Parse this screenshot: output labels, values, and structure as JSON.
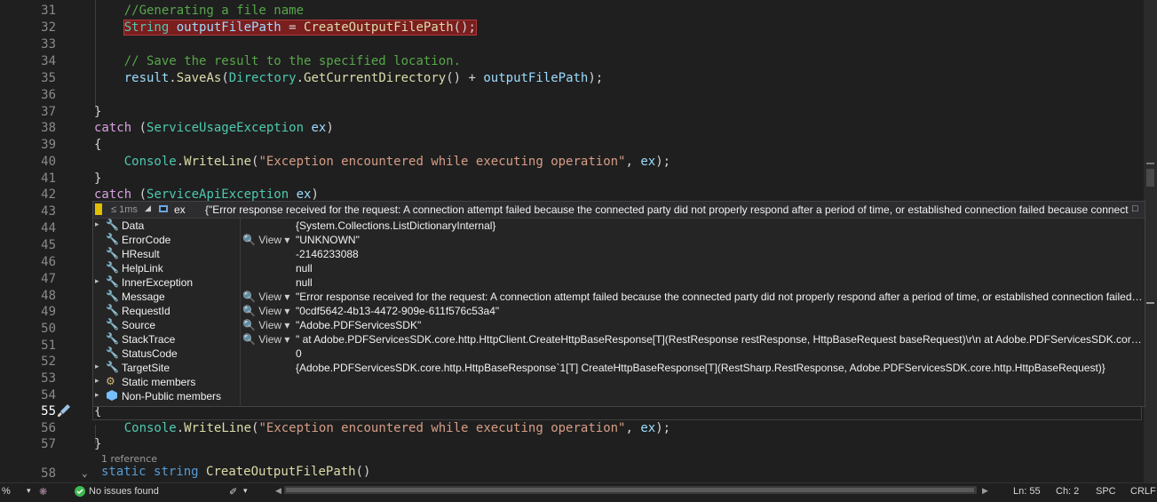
{
  "line_numbers": [
    "31",
    "32",
    "33",
    "34",
    "35",
    "36",
    "37",
    "38",
    "39",
    "40",
    "41",
    "42",
    "43",
    "44",
    "45",
    "46",
    "47",
    "48",
    "49",
    "50",
    "51",
    "52",
    "53",
    "54",
    "55",
    "56",
    "57",
    "58"
  ],
  "active_line": "55",
  "code": {
    "l31_comment": "//Generating a file name",
    "l32_type": "String",
    "l32_var": "outputFilePath",
    "l32_eq": " = ",
    "l32_fn": "CreateOutputFilePath",
    "l32_end": "();",
    "l34_comment": "// Save the result to the specified location.",
    "l35_obj": "result",
    "l35_dot": ".",
    "l35_fn": "SaveAs",
    "l35_p1": "(",
    "l35_cls": "Directory",
    "l35_dot2": ".",
    "l35_fn2": "GetCurrentDirectory",
    "l35_p2": "() + ",
    "l35_var": "outputFilePath",
    "l35_end": ");",
    "l37": "}",
    "l38_kw": "catch",
    "l38_p": " (",
    "l38_ty": "ServiceUsageException",
    "l38_var": " ex",
    "l38_end": ")",
    "l39": "{",
    "l40_cls": "Console",
    "l40_dot": ".",
    "l40_fn": "WriteLine",
    "l40_p": "(",
    "l40_str": "\"Exception encountered while executing operation\"",
    "l40_mid": ", ",
    "l40_var": "ex",
    "l40_end": ");",
    "l41": "}",
    "l42_kw": "catch",
    "l42_p": " (",
    "l42_ty": "ServiceApiException",
    "l42_var": " ex",
    "l42_end": ")",
    "l55": "{",
    "l56_cls": "Console",
    "l56_dot": ".",
    "l56_fn": "WriteLine",
    "l56_p": "(",
    "l56_str": "\"Exception encountered while executing operation\"",
    "l56_mid": ", ",
    "l56_var": "ex",
    "l56_end": ");",
    "l57": "}",
    "l58_kw1": "static",
    "l58_kw2": "string",
    "l58_fn": "CreateOutputFilePath",
    "l58_end": "()",
    "codelens": "1 reference",
    "timing": "≤ 1ms"
  },
  "datatip": {
    "header_name": "ex",
    "header_value": "{\"Error response received for the request: A connection attempt failed because the connected party did not properly respond after a period of time, or established connection failed because connect...",
    "view_label": "View",
    "rows": [
      {
        "name": "Data",
        "value": "{System.Collections.ListDictionaryInternal}",
        "expandable": true,
        "has_view": false
      },
      {
        "name": "ErrorCode",
        "value": "\"UNKNOWN\"",
        "expandable": false,
        "has_view": true
      },
      {
        "name": "HResult",
        "value": "-2146233088",
        "expandable": false,
        "has_view": false
      },
      {
        "name": "HelpLink",
        "value": "null",
        "expandable": false,
        "has_view": false
      },
      {
        "name": "InnerException",
        "value": "null",
        "expandable": true,
        "has_view": false
      },
      {
        "name": "Message",
        "value": "\"Error response received for the request: A connection attempt failed because the connected party did not properly respond after a period of time, or established connection failed b...",
        "expandable": false,
        "has_view": true
      },
      {
        "name": "RequestId",
        "value": "\"0cdf5642-4b13-4472-909e-611f576c53a4\"",
        "expandable": false,
        "has_view": true
      },
      {
        "name": "Source",
        "value": "\"Adobe.PDFServicesSDK\"",
        "expandable": false,
        "has_view": true
      },
      {
        "name": "StackTrace",
        "value": "\"   at Adobe.PDFServicesSDK.core.http.HttpClient.CreateHttpBaseResponse[T](RestResponse restResponse, HttpBaseRequest baseRequest)\\r\\n   at Adobe.PDFServicesSDK.core.http.I...",
        "expandable": false,
        "has_view": true
      },
      {
        "name": "StatusCode",
        "value": "0",
        "expandable": false,
        "has_view": false
      },
      {
        "name": "TargetSite",
        "value": "{Adobe.PDFServicesSDK.core.http.HttpBaseResponse`1[T] CreateHttpBaseResponse[T](RestSharp.RestResponse, Adobe.PDFServicesSDK.core.http.HttpBaseRequest)}",
        "expandable": true,
        "has_view": false
      },
      {
        "name": "Static members",
        "value": "",
        "expandable": true,
        "has_view": false
      },
      {
        "name": "Non-Public members",
        "value": "",
        "expandable": true,
        "has_view": false
      }
    ]
  },
  "statusbar": {
    "zoom": "%",
    "issues": "No issues found",
    "line": "Ln: 55",
    "char": "Ch: 2",
    "spc": "SPC",
    "crlf": "CRLF"
  },
  "colors": {
    "background": "#1f1f1f",
    "breakpoint_highlight": "#7a1e1e",
    "datatip_bg": "#252526",
    "ok_green": "#3fb950"
  }
}
